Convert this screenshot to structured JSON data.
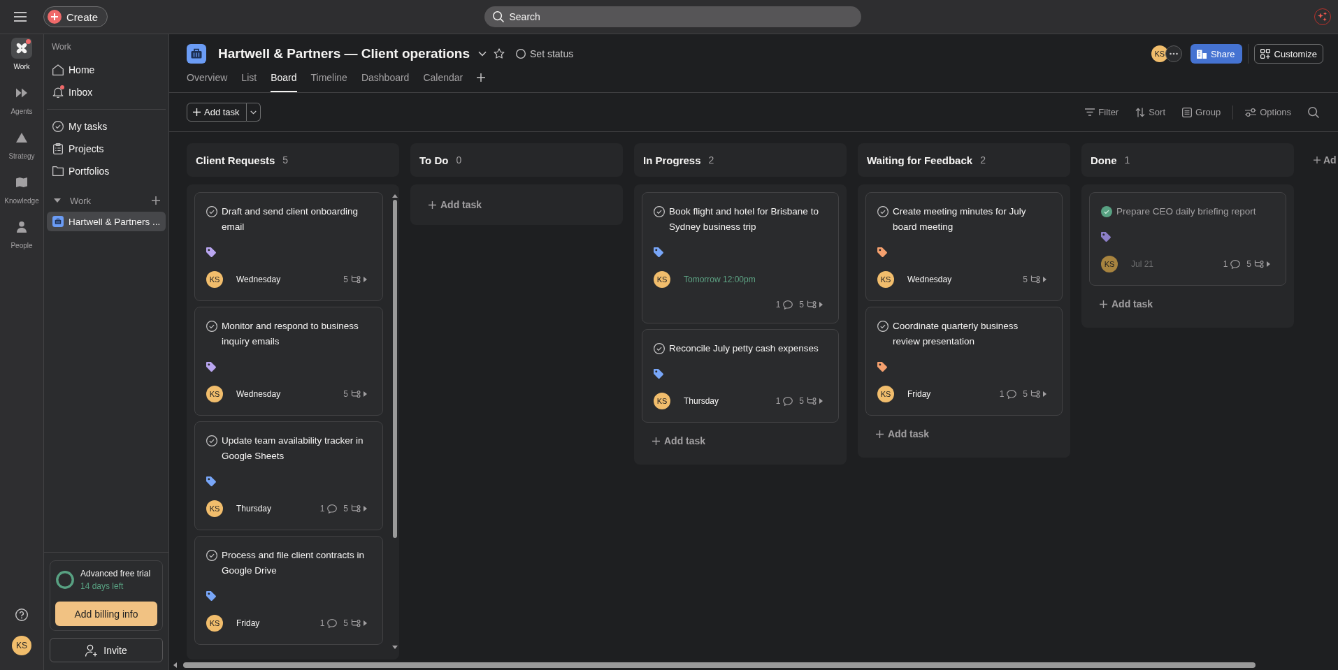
{
  "topbar": {
    "create_button": "Create",
    "search": {
      "placeholder": "Search"
    }
  },
  "rail": {
    "items": [
      {
        "label": "Work",
        "selected": true,
        "notification": true
      },
      {
        "label": "Agents",
        "selected": false,
        "notification": false
      },
      {
        "label": "Strategy",
        "selected": false,
        "notification": false
      },
      {
        "label": "Knowledge",
        "selected": false,
        "notification": false
      },
      {
        "label": "People",
        "selected": false,
        "notification": false
      }
    ],
    "user": {
      "initials": "KS"
    }
  },
  "sidebar": {
    "heading": "Work",
    "top_items": [
      {
        "label": "Home",
        "selected": false,
        "notification": false
      },
      {
        "label": "Inbox",
        "selected": false,
        "notification": true
      }
    ],
    "items": [
      {
        "label": "My tasks",
        "selected": false,
        "notification": false
      },
      {
        "label": "Projects",
        "selected": false,
        "notification": false
      },
      {
        "label": "Portfolios",
        "selected": false,
        "notification": false
      }
    ],
    "section": {
      "label": "Work",
      "expanded": true,
      "projects": [
        {
          "label": "Hartwell & Partners ...",
          "selected": true
        }
      ]
    },
    "trial": {
      "title": "Advanced free trial",
      "subtitle": "14 days left",
      "button": "Add billing info"
    },
    "invite_button": "Invite"
  },
  "project": {
    "title": "Hartwell & Partners — Client operations",
    "status_button": "Set status",
    "tabs": [
      {
        "label": "Overview",
        "selected": false
      },
      {
        "label": "List",
        "selected": false
      },
      {
        "label": "Board",
        "selected": true
      },
      {
        "label": "Timeline",
        "selected": false
      },
      {
        "label": "Dashboard",
        "selected": false
      },
      {
        "label": "Calendar",
        "selected": false
      }
    ],
    "members": [
      {
        "initials": "KS"
      }
    ],
    "share_button": "Share",
    "customize_button": "Customize"
  },
  "toolbar": {
    "add_task_button": "Add task",
    "actions": [
      {
        "label": "Filter"
      },
      {
        "label": "Sort"
      },
      {
        "label": "Group"
      },
      {
        "label": "Options"
      }
    ]
  },
  "board": {
    "columns": [
      {
        "title": "Client Requests",
        "count": "5",
        "scrollbar": true,
        "tasks": [
          {
            "title": "Draft and send client onboarding email",
            "completed": false,
            "tag": {
              "color": "#b9a6f0"
            },
            "assignee": "KS",
            "due": "Wednesday",
            "due_soon": false,
            "subtasks": "5"
          },
          {
            "title": "Monitor and respond to business inquiry emails",
            "completed": false,
            "tag": {
              "color": "#b9a6f0"
            },
            "assignee": "KS",
            "due": "Wednesday",
            "due_soon": false,
            "subtasks": "5"
          },
          {
            "title": "Update team availability tracker in Google Sheets",
            "completed": false,
            "tag": {
              "color": "#78a6f8"
            },
            "assignee": "KS",
            "due": "Thursday",
            "due_soon": false,
            "comments": "1",
            "subtasks": "5"
          },
          {
            "title": "Process and file client contracts in Google Drive",
            "completed": false,
            "tag": {
              "color": "#78a6f8"
            },
            "assignee": "KS",
            "due": "Friday",
            "due_soon": false,
            "comments": "1",
            "subtasks": "5"
          }
        ]
      },
      {
        "title": "To Do",
        "count": "0",
        "scrollbar": false,
        "add_task": "Add task"
      },
      {
        "title": "In Progress",
        "count": "2",
        "scrollbar": false,
        "tasks": [
          {
            "title": "Book flight and hotel for Brisbane to Sydney business trip",
            "completed": false,
            "tag": {
              "color": "#78a6f8"
            },
            "assignee": "KS",
            "due": "Tomorrow 12:00pm",
            "due_soon": true,
            "comments": "1",
            "subtasks": "5"
          },
          {
            "title": "Reconcile July petty cash expenses",
            "completed": false,
            "tag": {
              "color": "#78a6f8"
            },
            "assignee": "KS",
            "due": "Thursday",
            "due_soon": false,
            "comments": "1",
            "subtasks": "5"
          }
        ],
        "add_task": "Add task"
      },
      {
        "title": "Waiting for Feedback",
        "count": "2",
        "scrollbar": false,
        "tasks": [
          {
            "title": "Create meeting minutes for July board meeting",
            "completed": false,
            "tag": {
              "color": "#f5a06e"
            },
            "assignee": "KS",
            "due": "Wednesday",
            "due_soon": false,
            "subtasks": "5"
          },
          {
            "title": "Coordinate quarterly business review presentation",
            "completed": false,
            "tag": {
              "color": "#f5a06e"
            },
            "assignee": "KS",
            "due": "Friday",
            "due_soon": false,
            "comments": "1",
            "subtasks": "5"
          }
        ],
        "add_task": "Add task"
      },
      {
        "title": "Done",
        "count": "1",
        "scrollbar": false,
        "tasks": [
          {
            "title": "Prepare CEO daily briefing report",
            "completed": true,
            "tag": {
              "color": "#8c7fc7"
            },
            "assignee": "KS",
            "due": "Jul 21",
            "due_soon": false,
            "comments": "1",
            "subtasks": "5"
          }
        ],
        "add_task": "Add task"
      }
    ],
    "next_column_button": "Ad"
  }
}
